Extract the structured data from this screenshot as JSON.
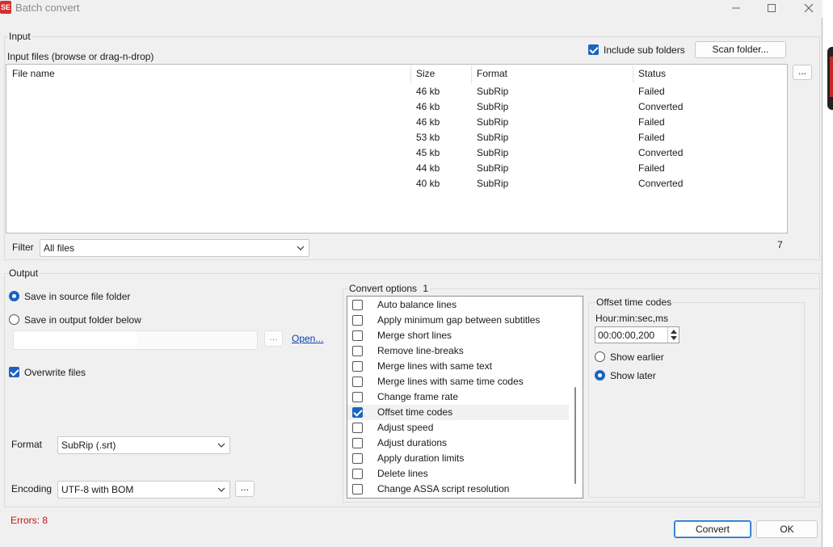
{
  "window": {
    "title": "Batch convert",
    "app_icon": "SE",
    "minimize_icon": "minimize-icon",
    "maximize_icon": "maximize-icon",
    "close_icon": "close-icon"
  },
  "input": {
    "group_label": "Input",
    "files_label": "Input files (browse or drag-n-drop)",
    "include_sub_folders": {
      "label": "Include sub folders",
      "checked": true
    },
    "scan_folder_label": "Scan folder...",
    "browse_label": "...",
    "columns": [
      "File name",
      "Size",
      "Format",
      "Status"
    ],
    "rows": [
      {
        "name": "",
        "size": "46 kb",
        "format": "SubRip",
        "status": "Failed"
      },
      {
        "name": "",
        "size": "46 kb",
        "format": "SubRip",
        "status": "Converted"
      },
      {
        "name": "",
        "size": "46 kb",
        "format": "SubRip",
        "status": "Failed"
      },
      {
        "name": "",
        "size": "53 kb",
        "format": "SubRip",
        "status": "Failed"
      },
      {
        "name": "",
        "size": "45 kb",
        "format": "SubRip",
        "status": "Converted"
      },
      {
        "name": "",
        "size": "44 kb",
        "format": "SubRip",
        "status": "Failed"
      },
      {
        "name": "",
        "size": "40 kb",
        "format": "SubRip",
        "status": "Converted"
      }
    ],
    "filter_label": "Filter",
    "filter_value": "All files",
    "file_count": "7"
  },
  "output": {
    "group_label": "Output",
    "save_in_source": {
      "label": "Save in source file folder",
      "selected": true
    },
    "save_in_output": {
      "label": "Save in output folder below",
      "selected": false
    },
    "folder_value": "",
    "folder_browse_label": "...",
    "open_link": "Open...",
    "overwrite": {
      "label": "Overwrite files",
      "checked": true
    },
    "format_label": "Format",
    "format_value": "SubRip (.srt)",
    "encoding_label": "Encoding",
    "encoding_value": "UTF-8 with BOM",
    "encoding_browse_label": "..."
  },
  "convert_options": {
    "label": "Convert options",
    "count": "1",
    "items": [
      {
        "label": "Auto balance lines",
        "checked": false
      },
      {
        "label": "Apply minimum gap between subtitles",
        "checked": false
      },
      {
        "label": "Merge short lines",
        "checked": false
      },
      {
        "label": "Remove line-breaks",
        "checked": false
      },
      {
        "label": "Merge lines with same text",
        "checked": false
      },
      {
        "label": "Merge lines with same time codes",
        "checked": false
      },
      {
        "label": "Change frame rate",
        "checked": false
      },
      {
        "label": "Offset time codes",
        "checked": true
      },
      {
        "label": "Adjust speed",
        "checked": false
      },
      {
        "label": "Adjust durations",
        "checked": false
      },
      {
        "label": "Apply duration limits",
        "checked": false
      },
      {
        "label": "Delete lines",
        "checked": false
      },
      {
        "label": "Change ASSA script resolution",
        "checked": false
      }
    ]
  },
  "offset_panel": {
    "title": "Offset time codes",
    "format_label": "Hour:min:sec,ms",
    "time_value": "00:00:00,200",
    "show_earlier": {
      "label": "Show earlier",
      "selected": false
    },
    "show_later": {
      "label": "Show later",
      "selected": true
    }
  },
  "footer": {
    "errors_text": "Errors: 8",
    "convert_label": "Convert",
    "ok_label": "OK"
  },
  "colors": {
    "window_bg": "#f0f0f0",
    "accent": "#1a63c4",
    "error": "#cc1010",
    "link": "#0645ad"
  }
}
